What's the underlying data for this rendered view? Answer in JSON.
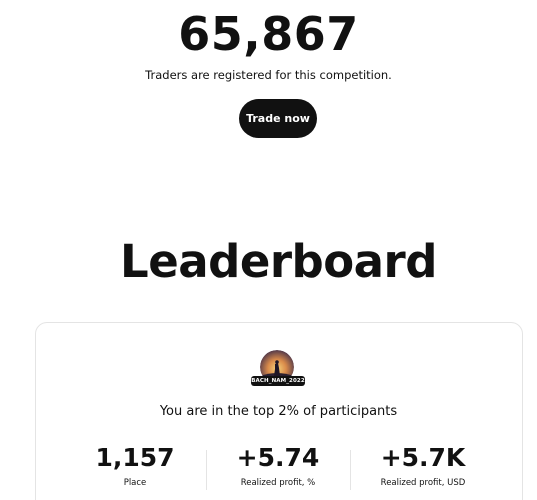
{
  "competition": {
    "trader_count": "65,867",
    "trader_caption": "Traders are registered for this competition.",
    "trade_button": "Trade now"
  },
  "leaderboard": {
    "title": "Leaderboard",
    "user": {
      "username": "BACH_NAM_2022",
      "rank_text": "You are in the top 2% of participants"
    },
    "stats": [
      {
        "value": "1,157",
        "label": "Place"
      },
      {
        "value": "+5.74",
        "label": "Realized profit, %"
      },
      {
        "value": "+5.7K",
        "label": "Realized profit, USD"
      }
    ]
  }
}
